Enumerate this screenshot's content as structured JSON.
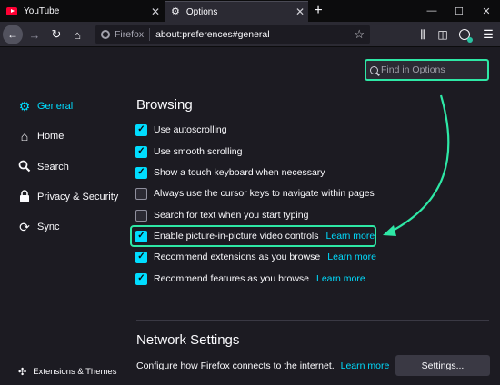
{
  "tabs": [
    {
      "title": "YouTube",
      "icon": "youtube-icon",
      "active": false
    },
    {
      "title": "Options",
      "icon": "gear-icon",
      "active": true
    }
  ],
  "toolbar": {
    "identity": "Firefox",
    "url": "about:preferences#general"
  },
  "search": {
    "placeholder": "Find in Options"
  },
  "categories": [
    {
      "label": "General",
      "icon": "gear-icon",
      "selected": true
    },
    {
      "label": "Home",
      "icon": "home-icon",
      "selected": false
    },
    {
      "label": "Search",
      "icon": "search-icon",
      "selected": false
    },
    {
      "label": "Privacy & Security",
      "icon": "lock-icon",
      "selected": false
    },
    {
      "label": "Sync",
      "icon": "sync-icon",
      "selected": false
    }
  ],
  "extensions_label": "Extensions & Themes",
  "browsing": {
    "title": "Browsing",
    "options": [
      {
        "label": "Use autoscrolling",
        "checked": true
      },
      {
        "label": "Use smooth scrolling",
        "checked": true
      },
      {
        "label": "Show a touch keyboard when necessary",
        "checked": true
      },
      {
        "label": "Always use the cursor keys to navigate within pages",
        "checked": false
      },
      {
        "label": "Search for text when you start typing",
        "checked": false
      },
      {
        "label": "Enable picture-in-picture video controls",
        "checked": true,
        "learn_more": "Learn more"
      },
      {
        "label": "Recommend extensions as you browse",
        "checked": true,
        "learn_more": "Learn more"
      },
      {
        "label": "Recommend features as you browse",
        "checked": true,
        "learn_more": "Learn more"
      }
    ]
  },
  "network": {
    "title": "Network Settings",
    "description": "Configure how Firefox connects to the internet.",
    "learn_more": "Learn more",
    "button": "Settings..."
  },
  "colors": {
    "accent": "#00ddff",
    "highlight": "#2ee8a6",
    "background": "#1c1b22"
  }
}
